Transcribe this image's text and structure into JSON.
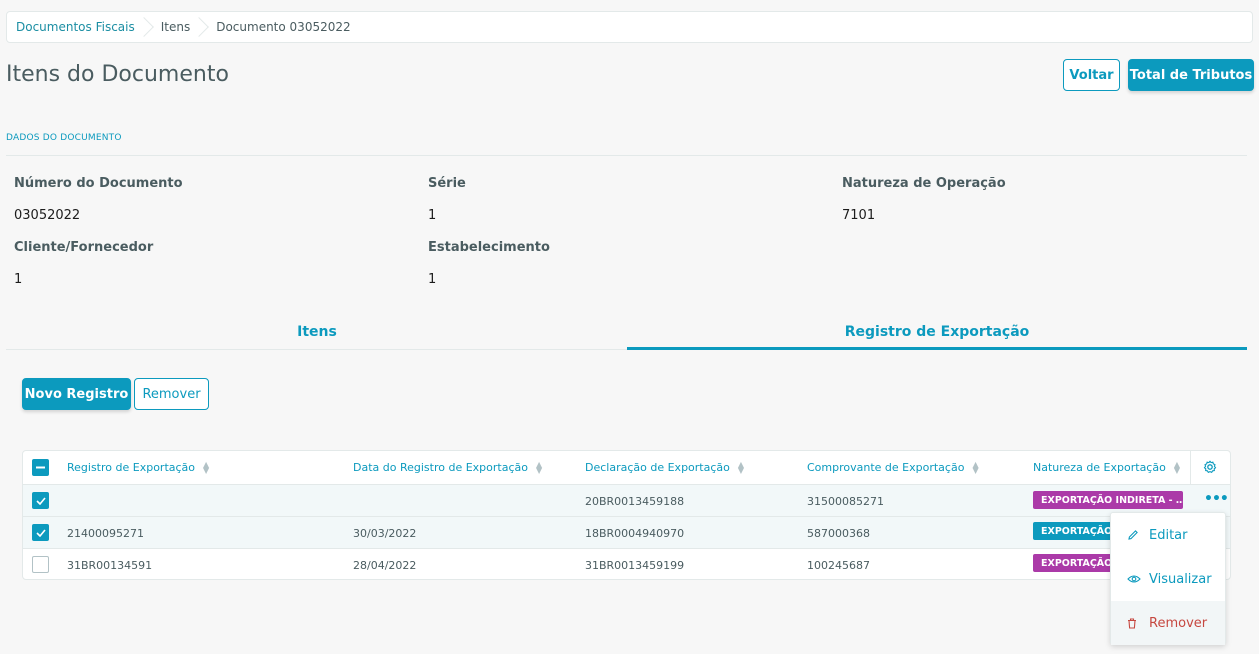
{
  "breadcrumb": {
    "items": [
      "Documentos Fiscais",
      "Itens",
      "Documento 03052022"
    ]
  },
  "page": {
    "title": "Itens do Documento",
    "back_label": "Voltar",
    "total_label": "Total de Tributos"
  },
  "document": {
    "section_label": "DADOS DO DOCUMENTO",
    "fields": [
      {
        "label": "Número do Documento",
        "value": "03052022"
      },
      {
        "label": "Série",
        "value": "1"
      },
      {
        "label": "Natureza de Operação",
        "value": "7101"
      },
      {
        "label": "Cliente/Fornecedor",
        "value": "1"
      },
      {
        "label": "Estabelecimento",
        "value": "1"
      }
    ]
  },
  "tabs": [
    {
      "label": "Itens",
      "active": false
    },
    {
      "label": "Registro de Exportação",
      "active": true
    }
  ],
  "actions": {
    "new_label": "Novo Registro",
    "remove_label": "Remover"
  },
  "table": {
    "columns": [
      "Registro de Exportação",
      "Data do Registro de Exportação",
      "Declaração de Exportação",
      "Comprovante de Exportação",
      "Natureza de Exportação"
    ],
    "rows": [
      {
        "registro": "",
        "data": "",
        "declaracao": "20BR0013459188",
        "comprovante": "31500085271",
        "natureza": "EXPORTAÇÃO INDIRETA - …",
        "checked": true
      },
      {
        "registro": "21400095271",
        "data": "30/03/2022",
        "declaracao": "18BR0004940970",
        "comprovante": "587000368",
        "natureza": "EXPORTAÇÃO",
        "checked": true
      },
      {
        "registro": "31BR00134591",
        "data": "28/04/2022",
        "declaracao": "31BR0013459199",
        "comprovante": "100245687",
        "natureza": "EXPORTAÇÃO",
        "checked": false
      }
    ]
  },
  "row_menu": {
    "items": [
      "Editar",
      "Visualizar",
      "Remover"
    ]
  },
  "colors": {
    "primary": "#0c9abe",
    "tag_purple": "#ab3aa8",
    "danger": "#c64840"
  }
}
